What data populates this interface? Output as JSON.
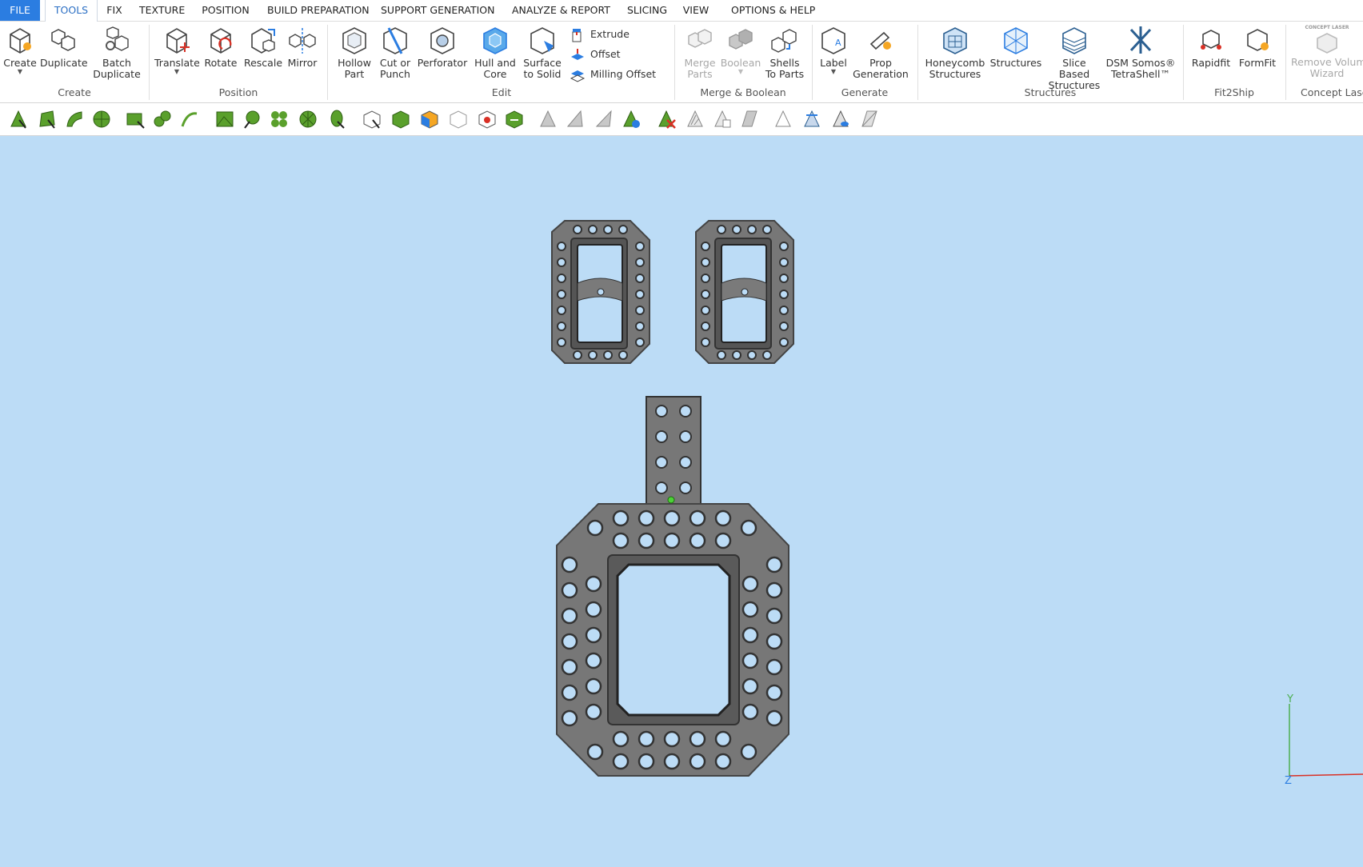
{
  "menu": {
    "file": "FILE",
    "tabs": [
      "TOOLS",
      "FIX",
      "TEXTURE",
      "POSITION",
      "BUILD PREPARATION",
      "SUPPORT GENERATION",
      "ANALYZE & REPORT",
      "SLICING",
      "VIEW",
      "OPTIONS & HELP"
    ]
  },
  "ribbon": {
    "create": [
      "Create"
    ],
    "duplicate": [
      "Duplicate"
    ],
    "batch": [
      "Batch",
      "Duplicate"
    ],
    "translate": [
      "Translate"
    ],
    "rotate": [
      "Rotate"
    ],
    "rescale": [
      "Rescale"
    ],
    "mirror": [
      "Mirror"
    ],
    "hollow": [
      "Hollow",
      "Part"
    ],
    "cut": [
      "Cut or",
      "Punch"
    ],
    "perforator": [
      "Perforator"
    ],
    "hull": [
      "Hull and",
      "Core"
    ],
    "surface": [
      "Surface",
      "to Solid"
    ],
    "extrude": "Extrude",
    "offset": "Offset",
    "milling": "Milling Offset",
    "merge": [
      "Merge",
      "Parts"
    ],
    "boolean": [
      "Boolean"
    ],
    "shells": [
      "Shells",
      "To Parts"
    ],
    "label": [
      "Label"
    ],
    "prop": [
      "Prop",
      "Generation"
    ],
    "honeycomb": [
      "Honeycomb",
      "Structures"
    ],
    "structures": [
      "Structures"
    ],
    "slice": [
      "Slice Based",
      "Structures"
    ],
    "dsm": [
      "DSM Somos®",
      "TetraShell™"
    ],
    "rapidfit": [
      "Rapidfit"
    ],
    "formfit": [
      "FormFit"
    ],
    "removevol": [
      "Remove Volum",
      "Wizard"
    ],
    "concept_logo": "CONCEPT LASER"
  },
  "groups": {
    "create": "Create",
    "position": "Position",
    "edit": "Edit",
    "merge": "Merge & Boolean",
    "generate": "Generate",
    "structures": "Structures",
    "fit2ship": "Fit2Ship",
    "concept": "Concept Lase"
  },
  "axis": {
    "y": "Y",
    "z": "Z"
  },
  "colors": {
    "accent": "#2b7de1",
    "viewport": "#bcdcf6",
    "part": "#6f6f6f",
    "icon_green": "#5aa02c"
  }
}
